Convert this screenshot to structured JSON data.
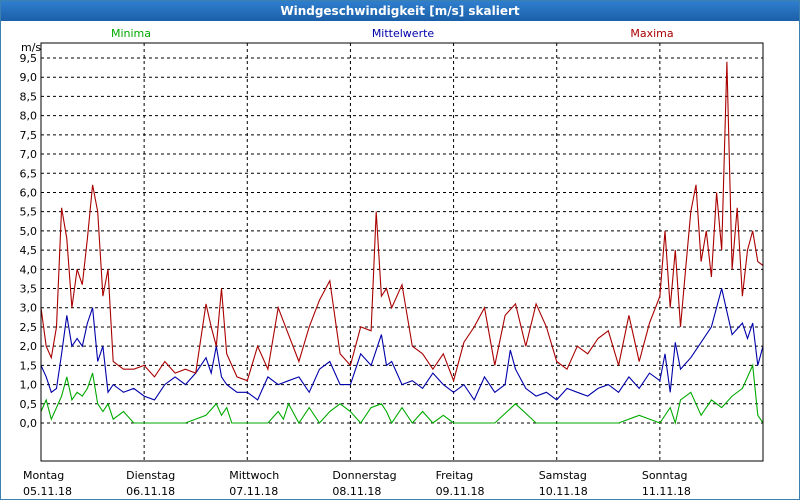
{
  "window": {
    "title": "Windgeschwindigkeit [m/s] skaliert"
  },
  "colors": {
    "min": "#00aa00",
    "mean": "#0000aa",
    "max": "#aa0000",
    "grid": "#000000"
  },
  "chart_data": {
    "type": "line",
    "title": "Windgeschwindigkeit [m/s] skaliert",
    "ylabel": "m/s",
    "ylim": [
      0,
      9.5
    ],
    "yticks": [
      "0,0",
      "0,5",
      "1,0",
      "1,5",
      "2,0",
      "2,5",
      "3,0",
      "3,5",
      "4,0",
      "4,5",
      "5,0",
      "5,5",
      "6,0",
      "6,5",
      "7,0",
      "7,5",
      "8,0",
      "8,5",
      "9,0",
      "9,5"
    ],
    "days": [
      {
        "name": "Montag",
        "date": "05.11.18"
      },
      {
        "name": "Dienstag",
        "date": "06.11.18"
      },
      {
        "name": "Mittwoch",
        "date": "07.11.18"
      },
      {
        "name": "Donnerstag",
        "date": "08.11.18"
      },
      {
        "name": "Freitag",
        "date": "09.11.18"
      },
      {
        "name": "Samstag",
        "date": "10.11.18"
      },
      {
        "name": "Sonntag",
        "date": "11.11.18"
      }
    ],
    "grid": true,
    "legend_position": "top",
    "x_range_days": [
      0,
      7
    ],
    "series": [
      {
        "name": "Minima",
        "color": "#00aa00",
        "x": [
          0,
          0.05,
          0.1,
          0.15,
          0.2,
          0.25,
          0.3,
          0.35,
          0.4,
          0.45,
          0.5,
          0.55,
          0.6,
          0.65,
          0.7,
          0.8,
          0.9,
          1.0,
          1.2,
          1.4,
          1.6,
          1.7,
          1.75,
          1.8,
          1.85,
          2.0,
          2.2,
          2.3,
          2.35,
          2.4,
          2.5,
          2.6,
          2.7,
          2.8,
          2.9,
          3.0,
          3.1,
          3.2,
          3.3,
          3.35,
          3.4,
          3.5,
          3.6,
          3.7,
          3.8,
          3.9,
          4.0,
          4.2,
          4.4,
          4.6,
          4.8,
          5.0,
          5.2,
          5.4,
          5.6,
          5.8,
          6.0,
          6.1,
          6.15,
          6.2,
          6.3,
          6.4,
          6.5,
          6.6,
          6.7,
          6.8,
          6.9,
          6.95,
          7.0
        ],
        "values": [
          0.3,
          0.6,
          0.1,
          0.4,
          0.7,
          1.2,
          0.6,
          0.8,
          0.7,
          0.9,
          1.3,
          0.5,
          0.3,
          0.5,
          0.1,
          0.3,
          0,
          0,
          0,
          0,
          0.2,
          0.5,
          0.2,
          0.4,
          0,
          0,
          0,
          0.3,
          0.1,
          0.5,
          0,
          0.4,
          0,
          0.3,
          0.5,
          0.3,
          0,
          0.4,
          0.5,
          0.3,
          0,
          0.4,
          0,
          0.3,
          0,
          0.2,
          0,
          0,
          0,
          0.5,
          0,
          0,
          0,
          0,
          0,
          0.2,
          0,
          0.4,
          0,
          0.6,
          0.8,
          0.2,
          0.6,
          0.4,
          0.7,
          0.9,
          1.5,
          0.2,
          0
        ]
      },
      {
        "name": "Mittelwerte",
        "color": "#0000aa",
        "x": [
          0,
          0.05,
          0.1,
          0.15,
          0.2,
          0.25,
          0.3,
          0.35,
          0.4,
          0.45,
          0.5,
          0.55,
          0.6,
          0.65,
          0.7,
          0.8,
          0.9,
          1.0,
          1.1,
          1.2,
          1.3,
          1.4,
          1.5,
          1.6,
          1.65,
          1.7,
          1.75,
          1.8,
          1.9,
          2.0,
          2.1,
          2.2,
          2.3,
          2.4,
          2.5,
          2.6,
          2.7,
          2.8,
          2.9,
          3.0,
          3.1,
          3.2,
          3.3,
          3.35,
          3.4,
          3.5,
          3.6,
          3.7,
          3.8,
          3.9,
          4.0,
          4.1,
          4.2,
          4.3,
          4.4,
          4.5,
          4.55,
          4.6,
          4.7,
          4.8,
          4.9,
          5.0,
          5.1,
          5.2,
          5.3,
          5.4,
          5.5,
          5.6,
          5.7,
          5.8,
          5.9,
          6.0,
          6.05,
          6.1,
          6.15,
          6.2,
          6.3,
          6.4,
          6.5,
          6.6,
          6.7,
          6.8,
          6.85,
          6.9,
          6.95,
          7.0
        ],
        "values": [
          1.5,
          1.2,
          0.8,
          0.9,
          1.8,
          2.8,
          2.0,
          2.2,
          2.0,
          2.6,
          3.0,
          1.6,
          2.0,
          0.8,
          1.0,
          0.8,
          0.9,
          0.7,
          0.6,
          1.0,
          1.2,
          1.0,
          1.3,
          1.7,
          1.3,
          2.0,
          1.2,
          1.0,
          0.8,
          0.8,
          0.6,
          1.2,
          1.0,
          1.1,
          1.2,
          0.8,
          1.4,
          1.6,
          1.0,
          1.0,
          1.8,
          1.5,
          2.3,
          1.5,
          1.6,
          1.0,
          1.1,
          0.9,
          1.3,
          1.0,
          0.8,
          1.0,
          0.6,
          1.2,
          0.8,
          1.0,
          1.9,
          1.4,
          0.9,
          0.7,
          0.8,
          0.6,
          0.9,
          0.8,
          0.7,
          0.9,
          1.0,
          0.8,
          1.2,
          0.9,
          1.3,
          1.1,
          1.8,
          0.8,
          2.1,
          1.4,
          1.7,
          2.1,
          2.5,
          3.5,
          2.3,
          2.6,
          2.2,
          2.6,
          1.5,
          2.0
        ]
      },
      {
        "name": "Maxima",
        "color": "#aa0000",
        "x": [
          0,
          0.05,
          0.1,
          0.15,
          0.2,
          0.25,
          0.3,
          0.35,
          0.4,
          0.45,
          0.5,
          0.55,
          0.6,
          0.65,
          0.7,
          0.8,
          0.9,
          1.0,
          1.1,
          1.2,
          1.3,
          1.4,
          1.5,
          1.6,
          1.65,
          1.7,
          1.75,
          1.8,
          1.9,
          2.0,
          2.1,
          2.2,
          2.3,
          2.4,
          2.5,
          2.6,
          2.7,
          2.8,
          2.9,
          3.0,
          3.1,
          3.2,
          3.25,
          3.3,
          3.35,
          3.4,
          3.5,
          3.6,
          3.7,
          3.8,
          3.9,
          4.0,
          4.1,
          4.2,
          4.3,
          4.4,
          4.5,
          4.6,
          4.7,
          4.8,
          4.9,
          5.0,
          5.1,
          5.2,
          5.3,
          5.4,
          5.5,
          5.6,
          5.7,
          5.8,
          5.9,
          6.0,
          6.05,
          6.1,
          6.15,
          6.2,
          6.25,
          6.3,
          6.35,
          6.4,
          6.45,
          6.5,
          6.55,
          6.6,
          6.65,
          6.7,
          6.75,
          6.8,
          6.85,
          6.9,
          6.95,
          7.0
        ],
        "values": [
          3.0,
          2.0,
          1.7,
          2.5,
          5.6,
          4.8,
          3.0,
          4.0,
          3.6,
          4.8,
          6.2,
          5.5,
          3.3,
          4.0,
          1.6,
          1.4,
          1.4,
          1.5,
          1.2,
          1.6,
          1.3,
          1.4,
          1.3,
          3.1,
          2.5,
          2.0,
          3.5,
          1.8,
          1.2,
          1.1,
          2.0,
          1.4,
          3.0,
          2.3,
          1.6,
          2.5,
          3.2,
          3.7,
          1.8,
          1.5,
          2.5,
          2.4,
          5.5,
          3.3,
          3.5,
          3.0,
          3.6,
          2.0,
          1.8,
          1.4,
          1.8,
          1.1,
          2.1,
          2.5,
          3.0,
          1.5,
          2.8,
          3.1,
          2.0,
          3.1,
          2.5,
          1.6,
          1.4,
          2.0,
          1.8,
          2.2,
          2.4,
          1.5,
          2.8,
          1.6,
          2.6,
          3.3,
          5.0,
          3.0,
          4.5,
          2.5,
          4.0,
          5.5,
          6.2,
          4.2,
          5.0,
          3.8,
          6.0,
          4.5,
          9.4,
          4.0,
          5.6,
          3.3,
          4.5,
          5.0,
          4.2,
          4.1
        ]
      }
    ]
  }
}
